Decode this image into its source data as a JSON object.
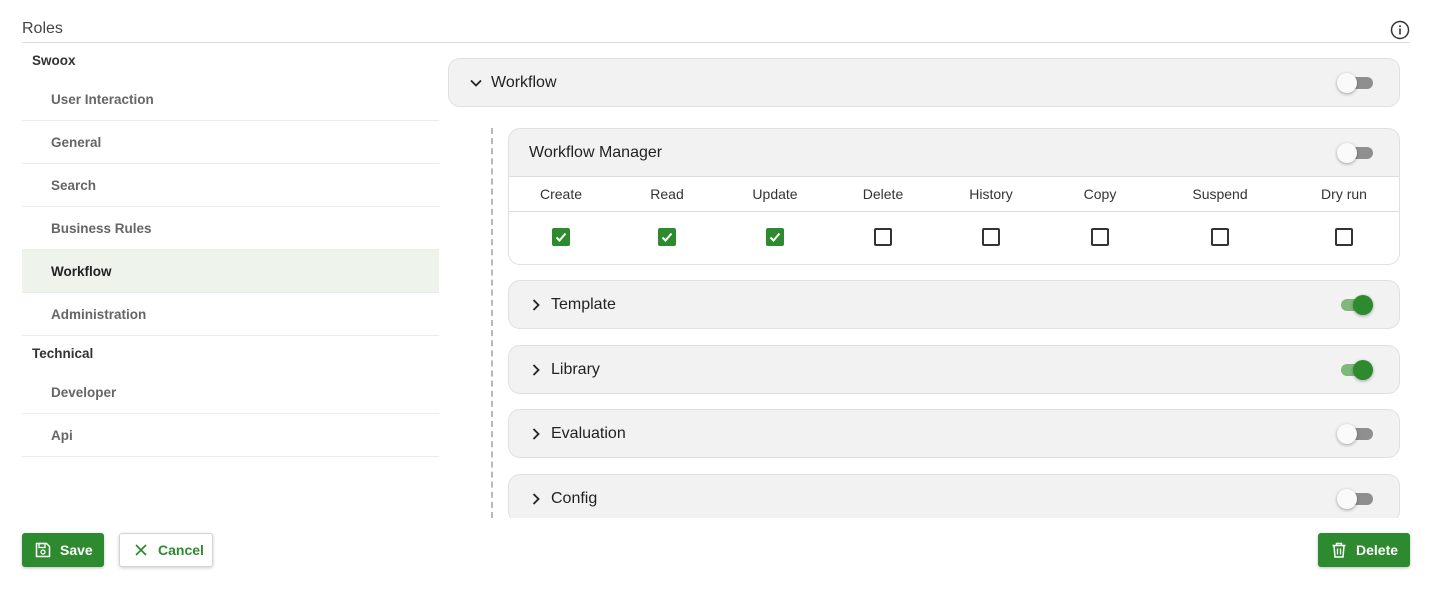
{
  "header": {
    "title": "Roles",
    "info_icon": "info-circle-icon"
  },
  "sidebar": {
    "groups": [
      {
        "label": "Swoox",
        "items": [
          "User Interaction",
          "General",
          "Search",
          "Business Rules",
          "Workflow",
          "Administration"
        ]
      },
      {
        "label": "Technical",
        "items": [
          "Developer",
          "Api"
        ]
      }
    ],
    "active_item": "Workflow"
  },
  "main": {
    "section": {
      "title": "Workflow",
      "expanded": true,
      "enabled": false
    },
    "workflow_manager": {
      "title": "Workflow Manager",
      "enabled": false,
      "permissions": [
        {
          "label": "Create",
          "checked": true
        },
        {
          "label": "Read",
          "checked": true
        },
        {
          "label": "Update",
          "checked": true
        },
        {
          "label": "Delete",
          "checked": false
        },
        {
          "label": "History",
          "checked": false
        },
        {
          "label": "Copy",
          "checked": false
        },
        {
          "label": "Suspend",
          "checked": false
        },
        {
          "label": "Dry run",
          "checked": false
        }
      ]
    },
    "subsections": [
      {
        "title": "Template",
        "enabled": true
      },
      {
        "title": "Library",
        "enabled": true
      },
      {
        "title": "Evaluation",
        "enabled": false
      },
      {
        "title": "Config",
        "enabled": false
      }
    ]
  },
  "footer": {
    "save_label": "Save",
    "cancel_label": "Cancel",
    "delete_label": "Delete"
  },
  "colors": {
    "accent": "#2e8a2e",
    "active_bg": "#eef3ec",
    "panel_bg": "#f2f2f2"
  }
}
